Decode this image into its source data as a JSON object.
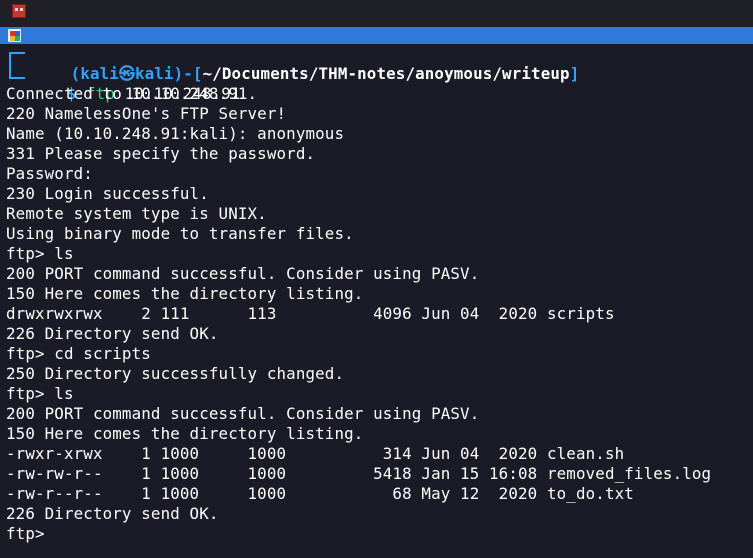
{
  "window": {
    "app_icon": "kali-terminal-icon",
    "tab_icon": "terminal-tab-icon"
  },
  "prompt": {
    "open_paren": "(",
    "user": "kali",
    "at_symbol": "㉿",
    "host": "kali",
    "close_paren": ")-[",
    "path": "~/Documents/THM-notes/anoymous/writeup",
    "close_bracket": "]",
    "dollar": "$",
    "command": "ftp",
    "argument": "10.10.248.91"
  },
  "output": [
    "Connected to 10.10.248.91.",
    "220 NamelessOne's FTP Server!",
    "Name (10.10.248.91:kali): anonymous",
    "331 Please specify the password.",
    "Password:",
    "230 Login successful.",
    "Remote system type is UNIX.",
    "Using binary mode to transfer files.",
    "ftp> ls",
    "200 PORT command successful. Consider using PASV.",
    "150 Here comes the directory listing.",
    "drwxrwxrwx    2 111      113          4096 Jun 04  2020 scripts",
    "226 Directory send OK.",
    "ftp> cd scripts",
    "250 Directory successfully changed.",
    "ftp> ls",
    "200 PORT command successful. Consider using PASV.",
    "150 Here comes the directory listing.",
    "-rwxr-xrwx    1 1000     1000          314 Jun 04  2020 clean.sh",
    "-rw-rw-r--    1 1000     1000         5418 Jan 15 16:08 removed_files.log",
    "-rw-r--r--    1 1000     1000           68 May 12  2020 to_do.txt",
    "226 Directory send OK.",
    "ftp> "
  ],
  "colors": {
    "background": "#1a1b26",
    "prompt_blue": "#30a3ff",
    "prompt_green": "#37d67a",
    "tab_strip": "#2f7ad9",
    "text": "#ffffff"
  }
}
